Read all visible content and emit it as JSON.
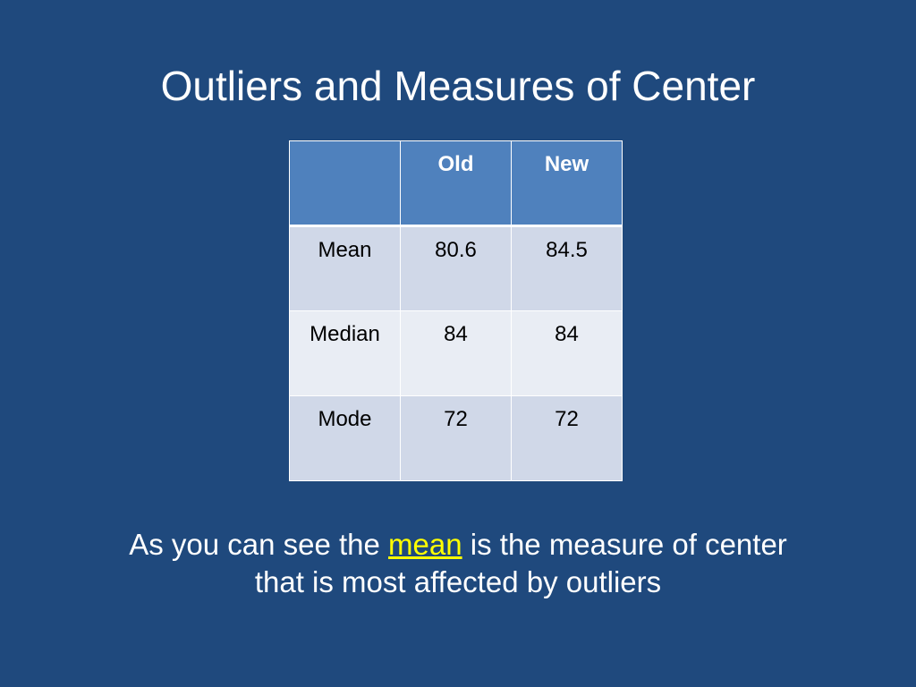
{
  "slide": {
    "title": "Outliers and Measures of Center",
    "table": {
      "headers": [
        "",
        "Old",
        "New"
      ],
      "rows": [
        [
          "Mean",
          "80.6",
          "84.5"
        ],
        [
          "Median",
          "84",
          "84"
        ],
        [
          "Mode",
          "72",
          "72"
        ]
      ]
    },
    "body": {
      "before": "As you can see the ",
      "highlight": "mean",
      "after": " is the measure of center",
      "line2": "that is most affected by outliers"
    },
    "colors": {
      "background": "#1f497d",
      "header": "#4f81bd",
      "row_odd": "#d0d8e8",
      "row_even": "#e9edf4",
      "highlight": "#ffff00"
    }
  }
}
